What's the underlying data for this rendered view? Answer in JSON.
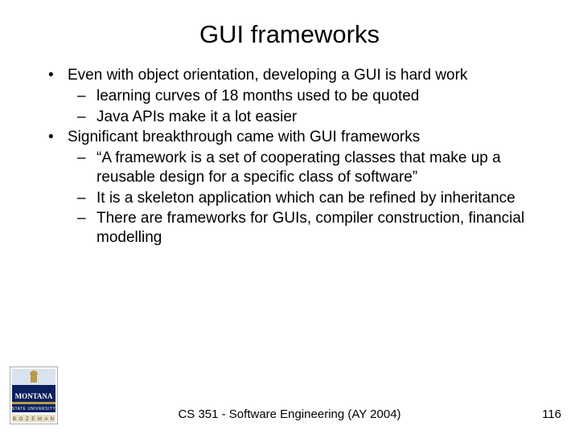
{
  "title": "GUI frameworks",
  "bullets": [
    {
      "text": "Even with object orientation, developing a GUI is hard work",
      "sub": [
        "learning curves of 18 months used to be quoted",
        "Java APIs make it a lot easier"
      ]
    },
    {
      "text": "Significant breakthrough came with GUI frameworks",
      "sub": [
        "“A framework is a set of cooperating classes that make up a reusable design for a specific class of software”",
        "It is a skeleton application which can be refined by inheritance",
        "There are frameworks for GUIs, compiler construction, financial modelling"
      ]
    }
  ],
  "footer": {
    "center": "CS 351 - Software Engineering (AY 2004)",
    "page": "116"
  },
  "logo": {
    "top_text": "MONTANA",
    "bottom_text": "B O Z E M A N"
  }
}
